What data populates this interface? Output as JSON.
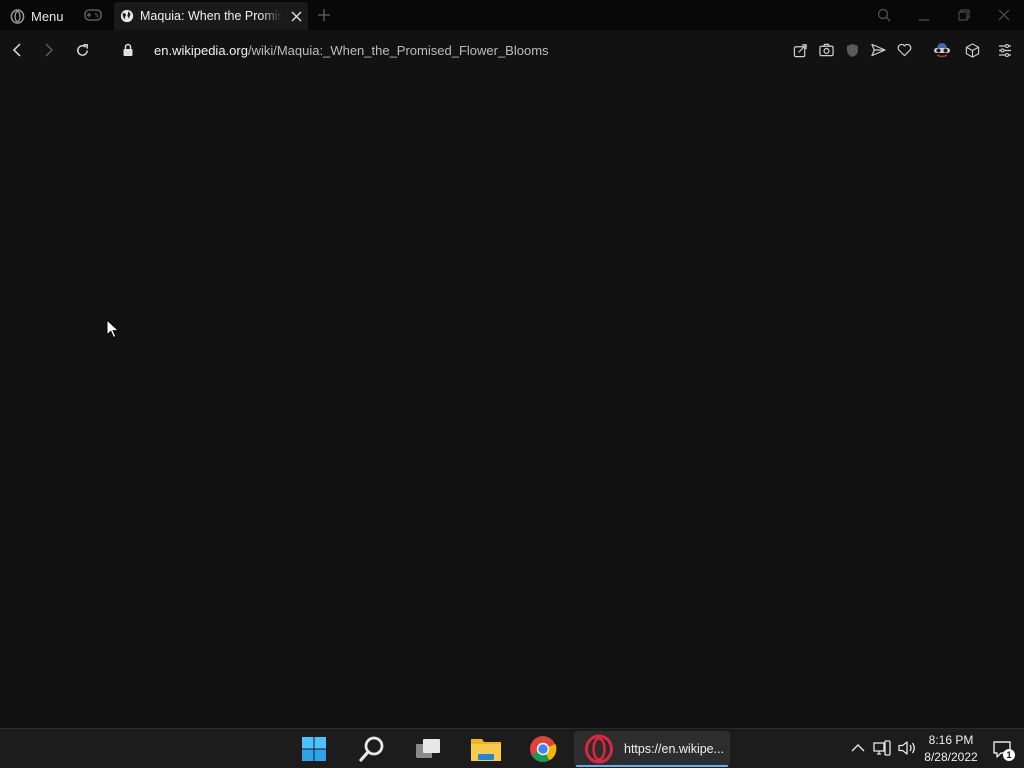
{
  "browser": {
    "menu_label": "Menu",
    "tab": {
      "title": "Maquia: When the Promised Flower Blooms",
      "favicon": "globe-icon"
    },
    "address": {
      "host": "en.wikipedia.org",
      "path": "/wiki/Maquia:_When_the_Promised_Flower_Blooms",
      "secure_icon": "lock-icon"
    },
    "toolbar_icons": [
      "back-icon",
      "forward-icon",
      "reload-icon",
      "share-icon",
      "snapshot-icon",
      "shield-icon",
      "send-icon",
      "heart-icon",
      "vpn-mask-icon",
      "cube-icon",
      "easy-setup-icon"
    ],
    "window_controls": [
      "search-tabs-icon",
      "minimize-icon",
      "restore-icon",
      "close-window-icon"
    ]
  },
  "taskbar": {
    "apps": [
      "windows-start-icon",
      "search-icon",
      "task-view-icon",
      "file-explorer-icon",
      "chrome-icon"
    ],
    "opera_task_label": "https://en.wikipe...",
    "tray_icons": [
      "chevron-up-icon",
      "network-icon",
      "volume-icon"
    ],
    "clock": {
      "time": "8:16 PM",
      "date": "8/28/2022"
    },
    "notification_count": "1"
  },
  "colors": {
    "background": "#121212",
    "tabstrip": "#080808",
    "taskbar": "#1c1c1c",
    "opera_red": "#e0263f",
    "active_indicator": "#5fb2f2"
  }
}
